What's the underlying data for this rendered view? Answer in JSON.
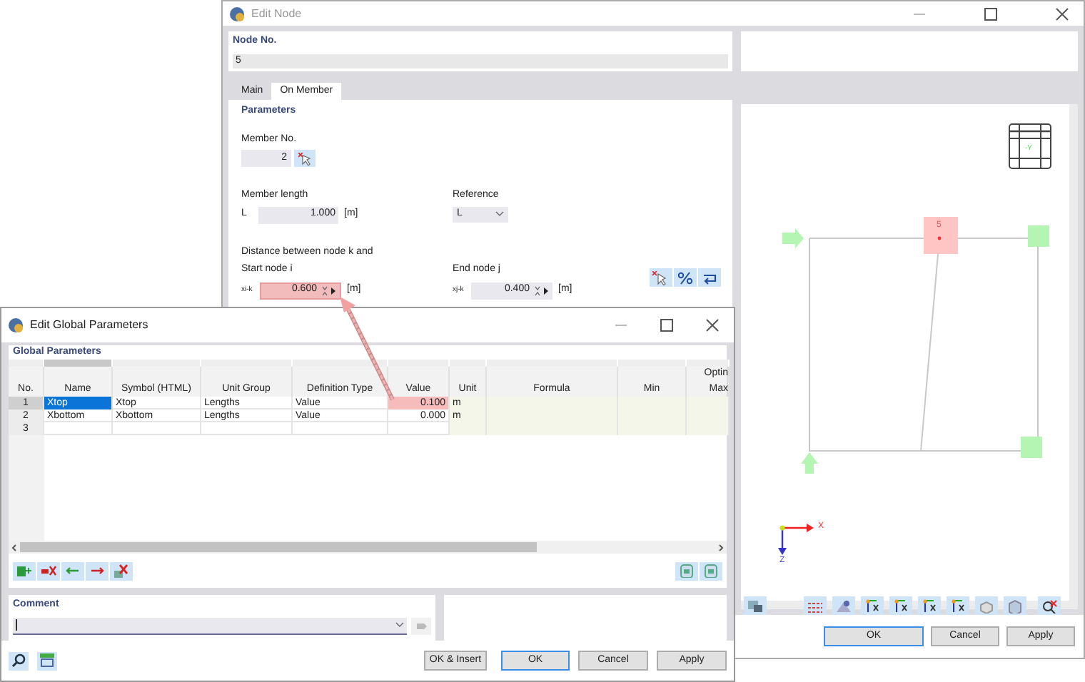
{
  "edit_node": {
    "title": "Edit Node",
    "node_no": {
      "label": "Node No.",
      "value": "5"
    },
    "tabs": [
      {
        "label": "Main",
        "selected": false
      },
      {
        "label": "On Member",
        "selected": true
      }
    ],
    "parameters": {
      "title": "Parameters",
      "member_no": {
        "label": "Member No.",
        "value": "2"
      },
      "member_length": {
        "label": "Member length",
        "symbol": "L",
        "value": "1.000",
        "unit": "[m]"
      },
      "reference": {
        "label": "Reference",
        "value": "L"
      },
      "distance_label": "Distance between node k and",
      "start_node": {
        "label": "Start node i",
        "symbol": "xi-k",
        "value": "0.600",
        "unit": "[m]",
        "highlighted": true
      },
      "end_node": {
        "label": "End node j",
        "symbol": "xj-k",
        "value": "0.400",
        "unit": "[m]",
        "highlighted": false
      }
    },
    "graphic": {
      "node_label": "5",
      "view_cube_label": "-Y",
      "axis_x": "X",
      "axis_z": "Z"
    },
    "buttons": [
      {
        "label": "OK",
        "default": true
      },
      {
        "label": "Cancel",
        "default": false
      },
      {
        "label": "Apply",
        "default": false
      }
    ]
  },
  "global_parameters": {
    "title": "Edit Global Parameters",
    "section": "Global Parameters",
    "columns": [
      {
        "label": "No."
      },
      {
        "label": "Name"
      },
      {
        "label": "Symbol (HTML)"
      },
      {
        "label": "Unit Group"
      },
      {
        "label": "Definition Type"
      },
      {
        "label": "Value"
      },
      {
        "label": "Unit"
      },
      {
        "label": "Formula"
      },
      {
        "label": "Min"
      },
      {
        "label": "Optin",
        "label_2": "Max"
      }
    ],
    "rows": [
      {
        "no": "1",
        "name": "Xtop",
        "symbol": "Xtop",
        "unit_group": "Lengths",
        "definition_type": "Value",
        "value": "0.100",
        "unit": "m",
        "selected": true,
        "highlighted": true
      },
      {
        "no": "2",
        "name": "Xbottom",
        "symbol": "Xbottom",
        "unit_group": "Lengths",
        "definition_type": "Value",
        "value": "0.000",
        "unit": "m",
        "selected": false,
        "highlighted": false
      },
      {
        "no": "3",
        "selected": false,
        "highlighted": false
      }
    ],
    "comment": {
      "label": "Comment"
    },
    "buttons": [
      {
        "label": "OK & Insert",
        "default": false
      },
      {
        "label": "OK",
        "default": true
      },
      {
        "label": "Cancel",
        "default": false
      },
      {
        "label": "Apply",
        "default": false
      }
    ]
  }
}
